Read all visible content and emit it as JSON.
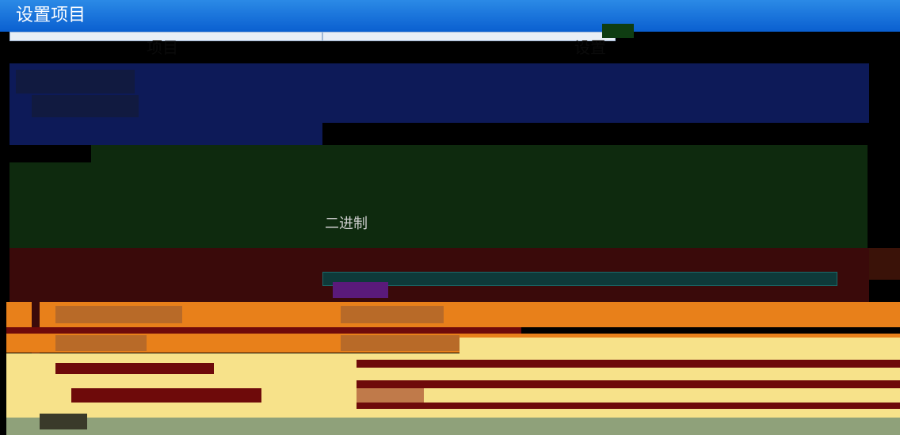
{
  "window": {
    "title": "设置项目"
  },
  "table": {
    "col1_header": "项目",
    "col2_header": "设置",
    "value_binary": "二进制"
  }
}
